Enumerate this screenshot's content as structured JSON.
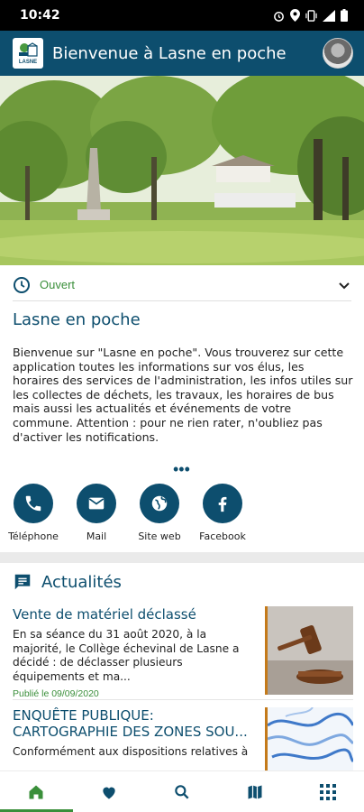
{
  "status_bar": {
    "time": "10:42",
    "icons": [
      "alarm-icon",
      "location-icon",
      "vibrate-icon",
      "signal-icon",
      "battery-icon"
    ]
  },
  "app_bar": {
    "logo_text": "LASNE",
    "title": "Bienvenue à Lasne en poche"
  },
  "hero": {
    "alt": "park-photo"
  },
  "status": {
    "open_text": "Ouvert"
  },
  "section": {
    "title": "Lasne en poche",
    "description": "Bienvenue sur \"Lasne en poche\". Vous trouverez sur cette application toutes les informations sur vos élus, les horaires des services de l'administration, les infos utiles sur les collectes de déchets, les travaux, les horaires de bus mais aussi les actualités et événements de votre commune. Attention : pour ne rien rater, n'oubliez pas d'activer les notifications.",
    "more": "•••"
  },
  "actions": [
    {
      "label": "Téléphone",
      "icon": "phone-icon"
    },
    {
      "label": "Mail",
      "icon": "mail-icon"
    },
    {
      "label": "Site web",
      "icon": "globe-icon"
    },
    {
      "label": "Facebook",
      "icon": "facebook-icon"
    }
  ],
  "news": {
    "title": "Actualités",
    "items": [
      {
        "headline": "Vente de matériel déclassé",
        "body": "En sa séance du 31 août 2020, à la majorité, le Collège échevinal de Lasne a décidé : de déclasser plusieurs équipements et ma...",
        "date": "Publié le 09/09/2020"
      },
      {
        "headline": "ENQUÊTE PUBLIQUE: CARTOGRAPHIE DES ZONES SOU...",
        "body": "Conformément aux dispositions relatives à"
      }
    ]
  },
  "bottom_nav": [
    {
      "name": "home",
      "active": true
    },
    {
      "name": "favorites",
      "active": false
    },
    {
      "name": "search",
      "active": false
    },
    {
      "name": "map",
      "active": false
    },
    {
      "name": "apps",
      "active": false
    }
  ],
  "colors": {
    "primary": "#0d4e6e",
    "accent_green": "#3a8f3a",
    "thumb_border": "#c47a1a"
  }
}
